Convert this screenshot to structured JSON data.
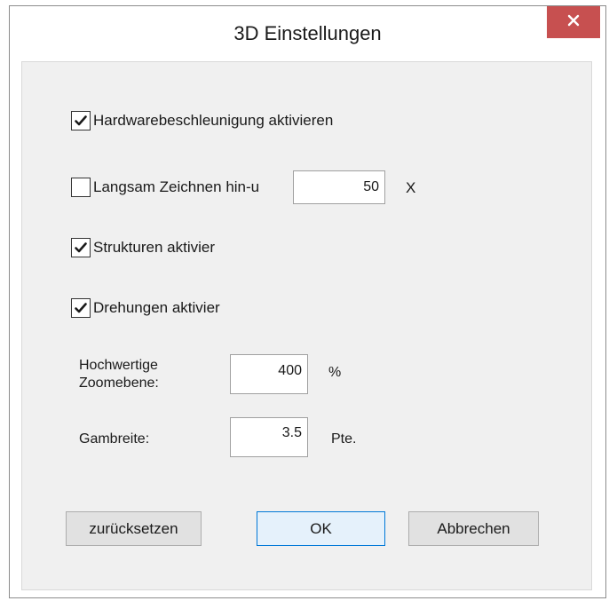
{
  "window": {
    "title": "3D Einstellungen"
  },
  "options": {
    "hardware_label": "Hardwarebeschleunigung aktivieren",
    "hardware_checked": true,
    "slow_draw_label": "Langsam Zeichnen hin-u",
    "slow_draw_checked": false,
    "slow_draw_value": "50",
    "slow_draw_unit": "X",
    "structures_label": "Strukturen aktivier",
    "structures_checked": true,
    "rotations_label": "Drehungen aktivier",
    "rotations_checked": true
  },
  "zoom": {
    "label_line1": "Hochwertige",
    "label_line2": "Zoomebene:",
    "value": "400",
    "unit": "%"
  },
  "gap": {
    "label": "Gambreite:",
    "value": "3.5",
    "unit": "Pte."
  },
  "buttons": {
    "reset_label": "zurücksetzen",
    "ok_label": "OK",
    "cancel_label": "Abbrechen"
  },
  "colors": {
    "close_button": "#c75050",
    "client_background": "#f0f0f0",
    "default_button_border": "#0078d7"
  },
  "icons": {
    "close": "close-icon",
    "check": "checkmark-icon"
  }
}
